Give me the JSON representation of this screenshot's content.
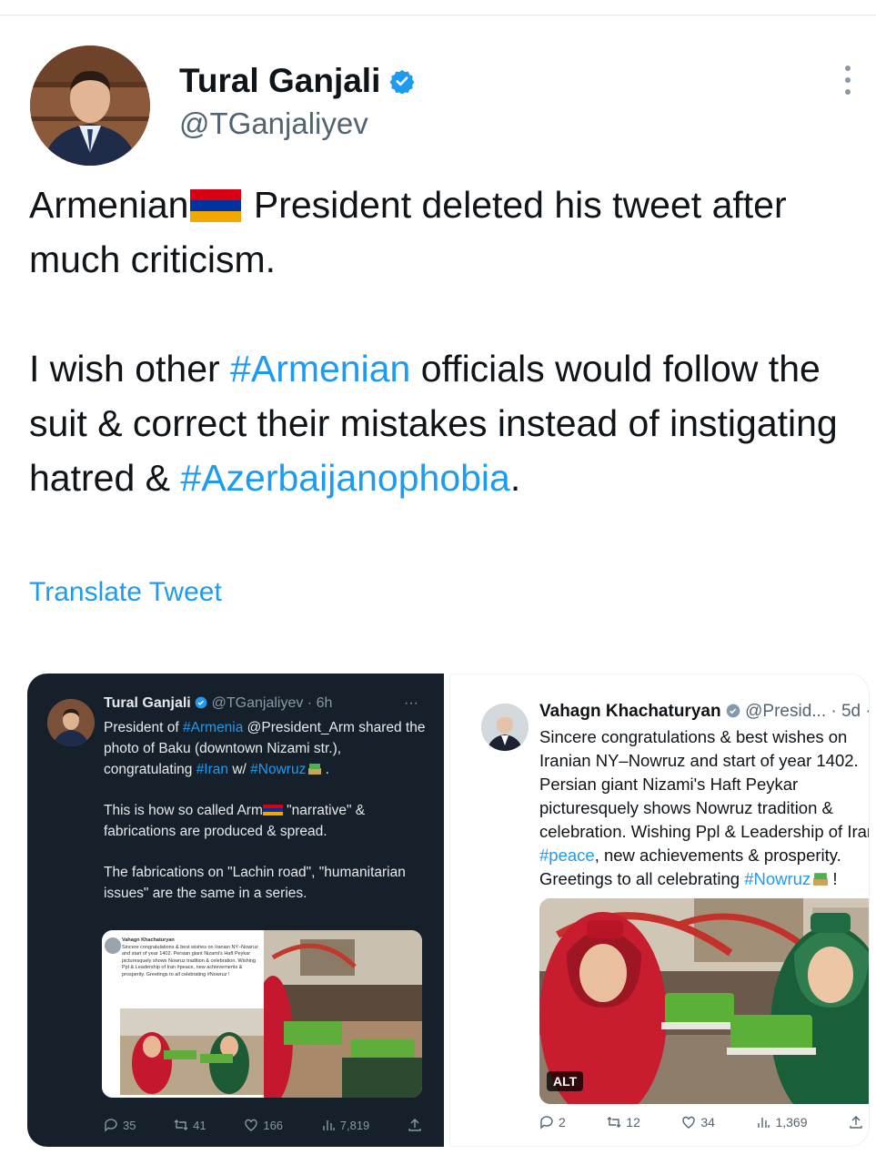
{
  "tweet": {
    "author_name": "Tural Ganjali",
    "handle": "@TGanjaliyev",
    "p1_a": "Armenian",
    "p1_b": " President deleted his tweet after much criticism.",
    "p2_a": "I wish other ",
    "p2_hash1": "#Armenian",
    "p2_b": " officials would follow the suit & correct their mistakes instead of instigating hatred & ",
    "p2_hash2": "#Azerbaijanophobia",
    "p2_c": ".",
    "translate_label": "Translate Tweet",
    "accent_color": "#1d9bf0"
  },
  "screenshot_left": {
    "author_name": "Tural Ganjali",
    "handle_time": "@TGanjaliyev · 6h",
    "more": "···",
    "line1_a": "President of ",
    "line1_hash": "#Armenia",
    "line1_b": " @President_Arm shared the photo of Baku (downtown Nizami str.), congratulating ",
    "line1_hash2": "#Iran",
    "line1_c": " w/ ",
    "line1_hash3": "#Nowruz",
    "line1_d": " .",
    "para2_a": "This is how so called Arm",
    "para2_b": " \"narrative\" & fabrications are produced & spread.",
    "para3": "The fabrications on \"Lachin road\", \"humanitarian issues\" are the same in a series.",
    "inner_name": "Vahagn Khachaturyan",
    "inner_text": "Sincere congratulations & best wishes on Iranian NY–Nowruz and start of year 1402. Persian giant Nizami's Haft Peykar picturesquely shows Nowruz tradition & celebration. Wishing Ppl & Leadership of Iran #peace, new achievements & prosperity. Greetings to all celebrating #Nowruz !",
    "replies": "35",
    "retweets": "41",
    "likes": "166",
    "views": "7,819"
  },
  "screenshot_right": {
    "author_name": "Vahagn Khachaturyan",
    "handle_time": "@Presid... · 5d",
    "more": "··",
    "lines": [
      "Sincere congratulations & best wishes on",
      "Iranian NY–Nowruz and start of year 1402.",
      "Persian giant Nizami's Haft Peykar",
      "picturesquely shows Nowruz tradition &",
      "celebration. Wishing Ppl & Leadership of Irar"
    ],
    "line6_hash": "#peace",
    "line6_rest": ", new achievements & prosperity.",
    "line7_a": "Greetings to all celebrating ",
    "line7_hash": "#Nowruz",
    "line7_b": " !",
    "alt_label": "ALT",
    "replies": "2",
    "retweets": "12",
    "likes": "34",
    "views": "1,369"
  }
}
